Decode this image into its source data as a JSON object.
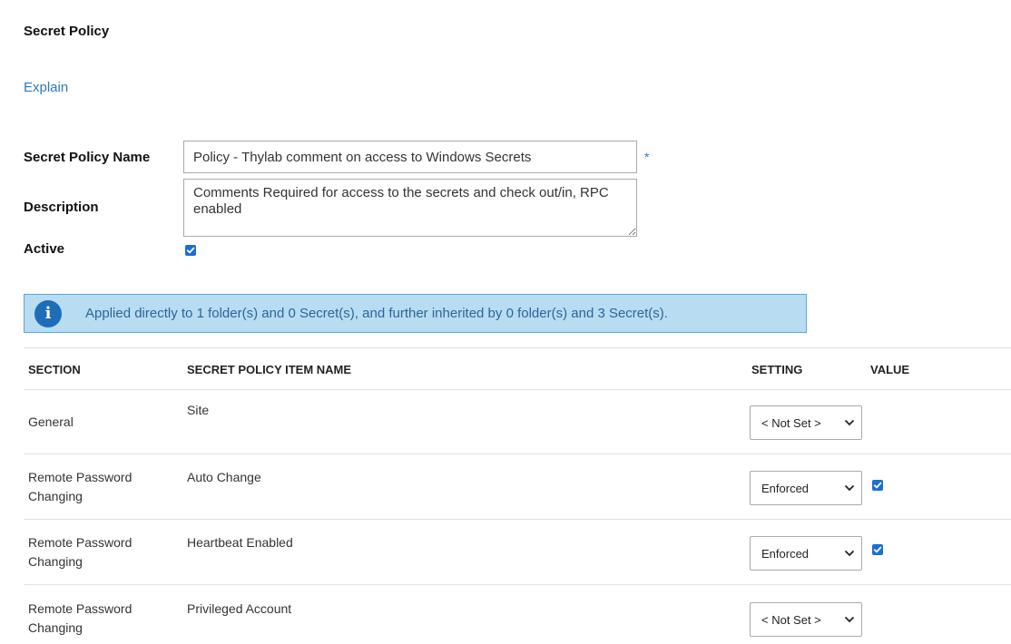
{
  "page": {
    "title": "Secret Policy",
    "explain_link": "Explain"
  },
  "form": {
    "name_label": "Secret Policy Name",
    "name_value": "Policy - Thylab comment on access to Windows Secrets",
    "required_mark": "*",
    "description_label": "Description",
    "description_value": "Comments Required for access to the secrets and check out/in, RPC enabled",
    "active_label": "Active",
    "active_checked": true
  },
  "info_banner": {
    "icon": "info-icon",
    "text": "Applied directly to 1 folder(s) and 0 Secret(s), and further inherited by 0 folder(s) and 3 Secret(s)."
  },
  "table": {
    "headers": {
      "section": "SECTION",
      "item_name": "SECRET POLICY ITEM NAME",
      "setting": "SETTING",
      "value": "VALUE"
    },
    "rows": [
      {
        "section": "General",
        "item": "Site",
        "setting": "< Not Set >",
        "value_checked": false
      },
      {
        "section": "Remote Password Changing",
        "item": "Auto Change",
        "setting": "Enforced",
        "value_checked": true
      },
      {
        "section": "Remote Password Changing",
        "item": "Heartbeat Enabled",
        "setting": "Enforced",
        "value_checked": true
      },
      {
        "section": "Remote Password Changing",
        "item": "Privileged Account",
        "setting": "< Not Set >",
        "value_checked": false
      }
    ]
  },
  "colors": {
    "link": "#2a7ac0",
    "checkbox": "#1a6fd1",
    "banner_bg": "#b8dcf2",
    "banner_border": "#5aa8de",
    "banner_text": "#2d6598",
    "info_icon": "#1f6cb8"
  }
}
